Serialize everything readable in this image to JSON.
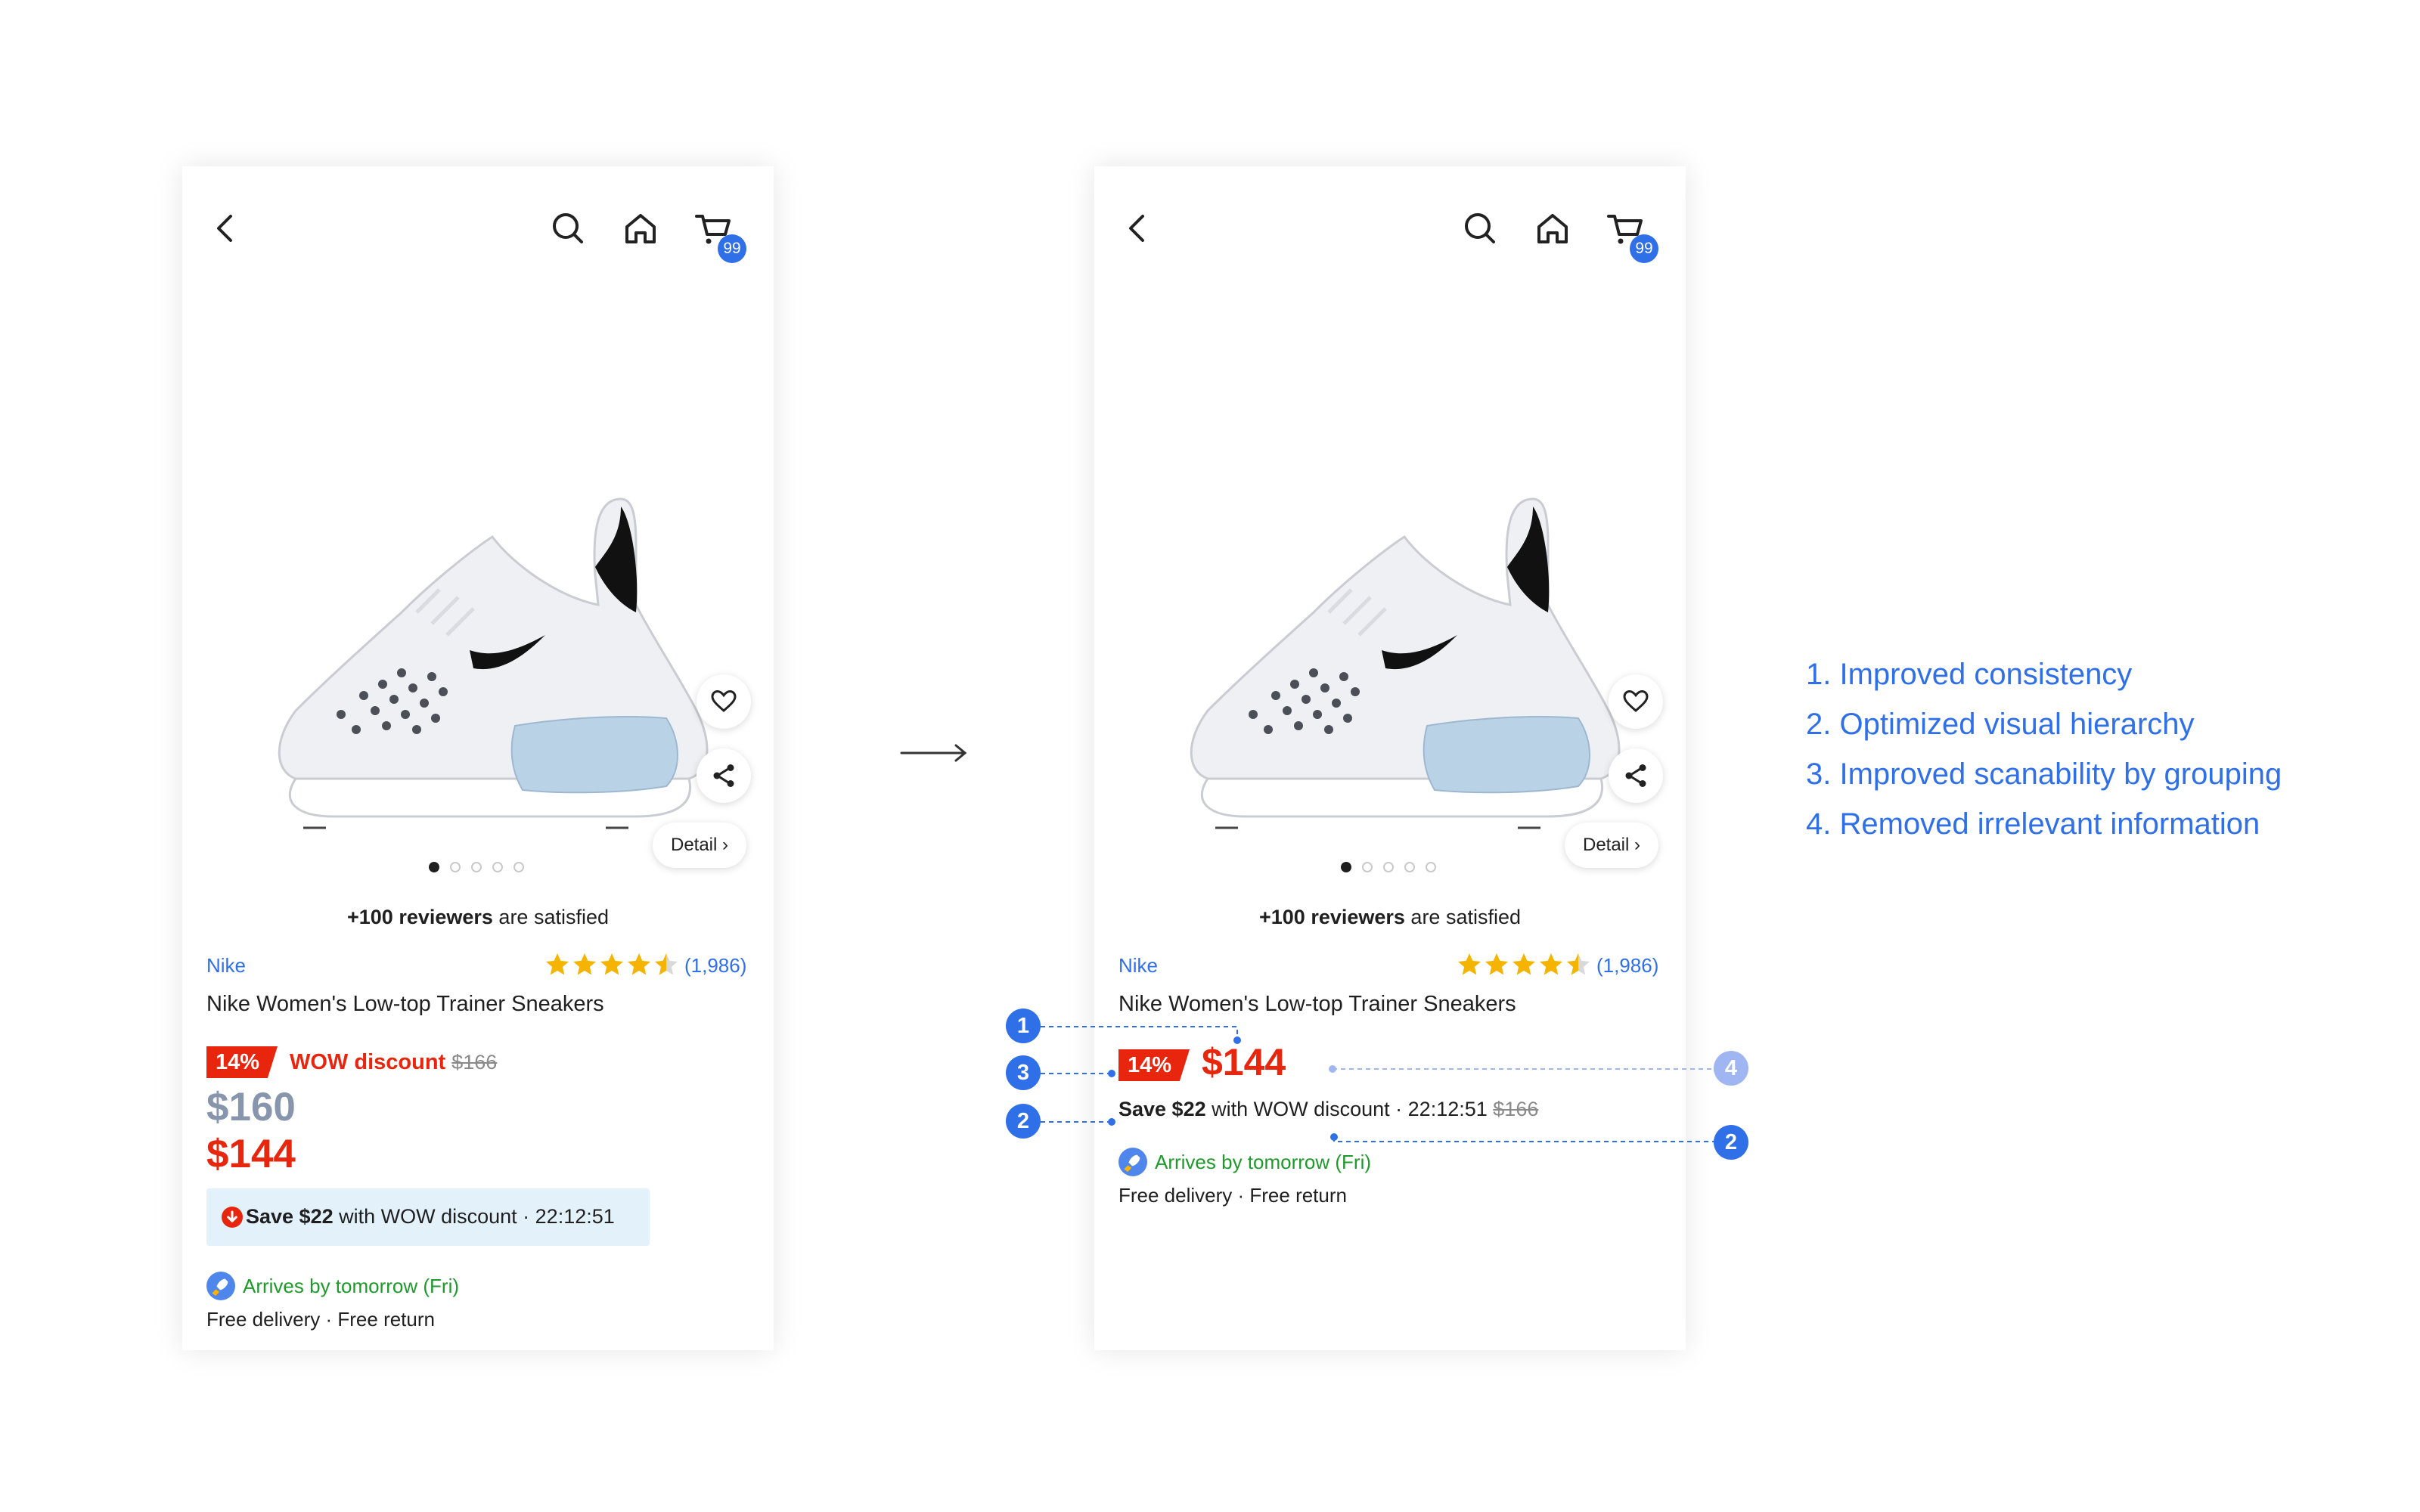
{
  "screens": {
    "left": {
      "cart_badge": "99",
      "detail_label": "Detail",
      "reviewers_bold": "+100 reviewers",
      "reviewers_text": " are satisfied",
      "brand": "Nike",
      "rating_value": 4.5,
      "rating_count": "(1,986)",
      "product_title": "Nike Women's Low-top Trainer Sneakers",
      "discount_pct": "14%",
      "discount_label": "WOW discount",
      "original_price": "$166",
      "list_price": "$160",
      "sale_price": "$144",
      "save_bold": "Save $22",
      "save_rest": " with WOW discount · 22:12:51",
      "arrives": "Arrives by tomorrow (Fri)",
      "delivery": "Free delivery · Free return"
    },
    "right": {
      "cart_badge": "99",
      "detail_label": "Detail",
      "reviewers_bold": "+100 reviewers",
      "reviewers_text": " are satisfied",
      "brand": "Nike",
      "rating_value": 4.5,
      "rating_count": "(1,986)",
      "product_title": "Nike Women's Low-top Trainer Sneakers",
      "discount_pct": "14%",
      "sale_price": "$144",
      "save_bold": "Save $22",
      "save_rest": " with WOW discount · 22:12:51",
      "original_price": "$166",
      "arrives": "Arrives by tomorrow (Fri)",
      "delivery": "Free delivery · Free return"
    }
  },
  "annotations": {
    "markers": [
      "1",
      "3",
      "2",
      "4",
      "2"
    ]
  },
  "notes": [
    "1. Improved consistency",
    "2. Optimized visual hierarchy",
    "3. Improved scanability by grouping",
    "4. Removed irrelevant information"
  ],
  "colors": {
    "accent": "#2f6fe8",
    "price_red": "#e8250d",
    "green": "#1e9a2b",
    "star": "#f5b400"
  }
}
